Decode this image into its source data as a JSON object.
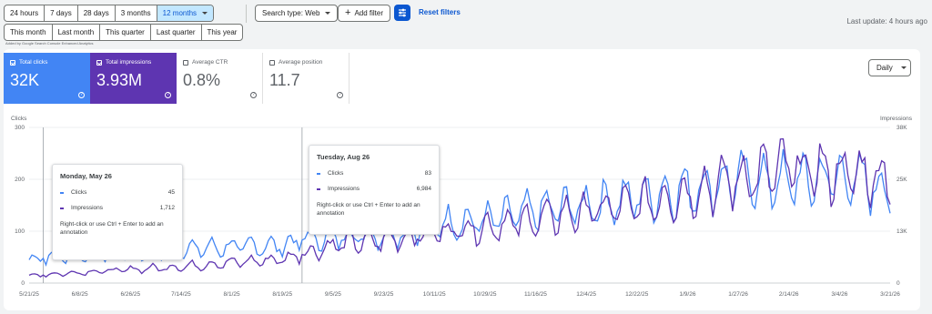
{
  "toolbar": {
    "ranges": [
      "24 hours",
      "7 days",
      "28 days",
      "3 months",
      "12 months"
    ],
    "presets": [
      "This month",
      "Last month",
      "This quarter",
      "Last quarter",
      "This year"
    ],
    "search_type": "Search type: Web",
    "add_filter": "Add filter",
    "reset_filters": "Reset filters",
    "last_update": "Last update: 4 hours ago",
    "added_by": "Added by Google Search Console Enhanced Analytics"
  },
  "metrics": {
    "clicks": {
      "label": "Total clicks",
      "value": "32K"
    },
    "impressions": {
      "label": "Total impressions",
      "value": "3.93M"
    },
    "ctr": {
      "label": "Average CTR",
      "value": "0.8%"
    },
    "position": {
      "label": "Average position",
      "value": "11.7"
    }
  },
  "granularity": "Daily",
  "tooltips": [
    {
      "date": "Monday, May 26",
      "clicks_label": "Clicks",
      "clicks": "45",
      "impressions_label": "Impressions",
      "impressions": "1,712",
      "note": "Right-click or use Ctrl + Enter to add an annotation"
    },
    {
      "date": "Tuesday, Aug 26",
      "clicks_label": "Clicks",
      "clicks": "83",
      "impressions_label": "Impressions",
      "impressions": "6,984",
      "note": "Right-click or use Ctrl + Enter to add an annotation"
    }
  ],
  "colors": {
    "clicks": "#4285f4",
    "impressions": "#5e35b1",
    "accent": "#0b57d0"
  },
  "chart_data": {
    "type": "line",
    "left_axis_label": "Clicks",
    "right_axis_label": "Impressions",
    "left_ticks": [
      "0",
      "100",
      "200",
      "300"
    ],
    "right_ticks": [
      "0",
      "13K",
      "25K",
      "38K"
    ],
    "ylim_left": [
      0,
      300
    ],
    "ylim_right": [
      0,
      38000
    ],
    "x_ticks": [
      "5/21/25",
      "6/8/25",
      "6/26/25",
      "7/14/25",
      "8/1/25",
      "8/19/25",
      "9/5/25",
      "9/23/25",
      "10/11/25",
      "10/29/25",
      "11/16/25",
      "12/4/25",
      "12/22/25",
      "1/9/26",
      "1/27/26",
      "2/14/26",
      "3/4/26",
      "3/21/26"
    ],
    "grid": true,
    "series": [
      {
        "name": "Clicks",
        "axis": "left",
        "anchors": [
          [
            0,
            45
          ],
          [
            18,
            55
          ],
          [
            36,
            55
          ],
          [
            54,
            65
          ],
          [
            72,
            70
          ],
          [
            90,
            72
          ],
          [
            97,
            83
          ],
          [
            110,
            90
          ],
          [
            126,
            95
          ],
          [
            144,
            115
          ],
          [
            162,
            120
          ],
          [
            180,
            140
          ],
          [
            198,
            150
          ],
          [
            216,
            165
          ],
          [
            234,
            180
          ],
          [
            252,
            200
          ],
          [
            270,
            195
          ],
          [
            288,
            205
          ],
          [
            306,
            180
          ]
        ]
      },
      {
        "name": "Impressions",
        "axis": "right",
        "anchors": [
          [
            0,
            1712
          ],
          [
            18,
            2600
          ],
          [
            36,
            3300
          ],
          [
            54,
            4000
          ],
          [
            72,
            5000
          ],
          [
            90,
            5800
          ],
          [
            97,
            6984
          ],
          [
            110,
            9500
          ],
          [
            126,
            10500
          ],
          [
            144,
            12500
          ],
          [
            162,
            13800
          ],
          [
            180,
            15500
          ],
          [
            198,
            17500
          ],
          [
            216,
            19000
          ],
          [
            234,
            22000
          ],
          [
            252,
            25500
          ],
          [
            270,
            28000
          ],
          [
            288,
            27000
          ],
          [
            306,
            26000
          ]
        ]
      }
    ]
  }
}
